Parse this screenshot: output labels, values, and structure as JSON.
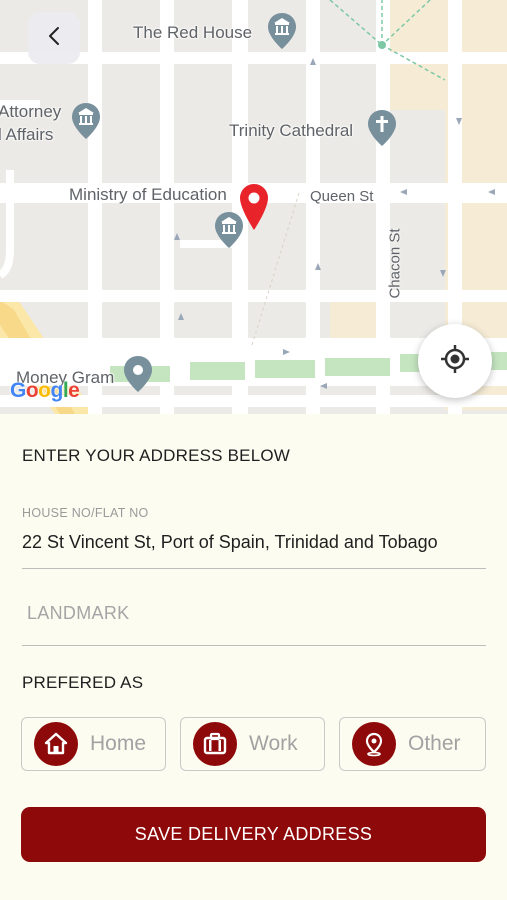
{
  "map": {
    "places": {
      "red_house": "The Red House",
      "attorney": "Attorney",
      "affairs": "l Affairs",
      "cathedral": "Trinity Cathedral",
      "ministry": "Ministry of Education",
      "money_gram": "Money Gram"
    },
    "streets": {
      "queen": "Queen St",
      "chacon": "Chacon St"
    },
    "attribution": "Google",
    "colors": {
      "pin": "#e8232a",
      "poi_icon": "#78909c"
    }
  },
  "icons": {
    "back": "chevron-left-icon",
    "locate": "my-location-icon",
    "home": "home-icon",
    "work": "briefcase-icon",
    "other": "location-pin-icon"
  },
  "form": {
    "heading": "ENTER YOUR ADDRESS BELOW",
    "house_label": "HOUSE NO/FLAT NO",
    "house_value": "22 St Vincent St, Port of Spain, Trinidad and Tobago",
    "landmark_placeholder": "LANDMARK",
    "landmark_value": ""
  },
  "preference": {
    "heading": "PREFERED AS",
    "options": [
      {
        "label": "Home"
      },
      {
        "label": "Work"
      },
      {
        "label": "Other"
      }
    ]
  },
  "actions": {
    "save_label": "SAVE DELIVERY ADDRESS"
  },
  "theme": {
    "accent": "#8e0a0a",
    "background": "#fdfcf1"
  }
}
